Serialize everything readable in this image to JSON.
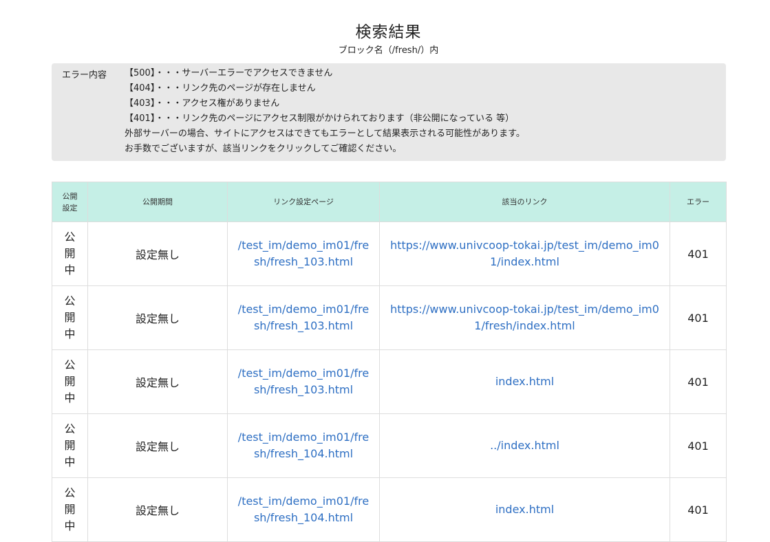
{
  "header": {
    "title": "検索結果",
    "subtitle": "ブロック名（/fresh/）内"
  },
  "notice": {
    "label": "エラー内容",
    "lines": [
      "【500】・・・サーバーエラーでアクセスできません",
      "【404】・・・リンク先のページが存在しません",
      "【403】・・・アクセス権がありません",
      "【401】・・・リンク先のページにアクセス制限がかけられております（非公開になっている 等）",
      "外部サーバーの場合、サイトにアクセスはできてもエラーとして結果表示される可能性があります。",
      "お手数でございますが、該当リンクをクリックしてご確認ください。"
    ]
  },
  "table": {
    "headers": {
      "status_line1": "公開",
      "status_line2": "設定",
      "period": "公開期間",
      "page": "リンク設定ページ",
      "link": "該当のリンク",
      "error": "エラー"
    },
    "rows": [
      {
        "status": [
          "公",
          "開",
          "中"
        ],
        "period": "設定無し",
        "page": "/test_im/demo_im01/fresh/fresh_103.html",
        "link": "https://www.univcoop-tokai.jp/test_im/demo_im01/index.html",
        "error": "401"
      },
      {
        "status": [
          "公",
          "開",
          "中"
        ],
        "period": "設定無し",
        "page": "/test_im/demo_im01/fresh/fresh_103.html",
        "link": "https://www.univcoop-tokai.jp/test_im/demo_im01/fresh/index.html",
        "error": "401"
      },
      {
        "status": [
          "公",
          "開",
          "中"
        ],
        "period": "設定無し",
        "page": "/test_im/demo_im01/fresh/fresh_103.html",
        "link": "index.html",
        "error": "401"
      },
      {
        "status": [
          "公",
          "開",
          "中"
        ],
        "period": "設定無し",
        "page": "/test_im/demo_im01/fresh/fresh_104.html",
        "link": "../index.html",
        "error": "401"
      },
      {
        "status": [
          "公",
          "開",
          "中"
        ],
        "period": "設定無し",
        "page": "/test_im/demo_im01/fresh/fresh_104.html",
        "link": "index.html",
        "error": "401"
      }
    ]
  },
  "colors": {
    "header_bg": "#c5efe6",
    "notice_bg": "#e8e8e8",
    "link": "#2e6fc3"
  }
}
